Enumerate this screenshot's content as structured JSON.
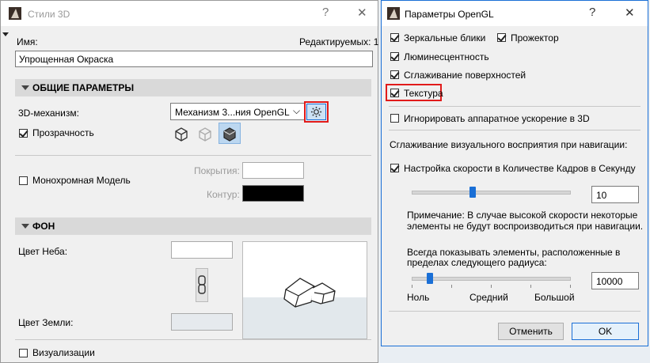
{
  "left_dialog": {
    "title": "Стили 3D",
    "help": "?",
    "close": "✕",
    "name_label": "Имя:",
    "editable_label": "Редактируемых: 1",
    "name_value": "Упрощенная Окраска",
    "general_section": "ОБЩИЕ ПАРАМЕТРЫ",
    "engine_label": "3D-механизм:",
    "engine_value": "Механизм 3...ния OpenGL",
    "transparency_label": "Прозрачность",
    "transparency_checked": true,
    "mono_label": "Монохромная Модель",
    "mono_checked": false,
    "surfaces_label": "Покрытия:",
    "contour_label": "Контур:",
    "background_section": "ФОН",
    "sky_label": "Цвет Неба:",
    "ground_label": "Цвет Земли:",
    "render_label": "Визуализации",
    "render_checked": false
  },
  "right_dialog": {
    "title": "Параметры OpenGL",
    "help": "?",
    "close": "✕",
    "specular_label": "Зеркальные блики",
    "specular_checked": true,
    "spotlight_label": "Прожектор",
    "spotlight_checked": true,
    "luminescence_label": "Люминесцентность",
    "luminescence_checked": true,
    "smoothing_label": "Сглаживание поверхностей",
    "smoothing_checked": true,
    "texture_label": "Текстура",
    "texture_checked": true,
    "ignore_hw_label": "Игнорировать аппаратное ускорение в 3D",
    "ignore_hw_checked": false,
    "nav_smoothing_label": "Сглаживание визуального восприятия при навигации:",
    "fps_label": "Настройка скорости в Количестве Кадров в Секунду",
    "fps_checked": true,
    "fps_value": "10",
    "fps_slider_fraction": 0.38,
    "note_line1": "Примечание: В случае высокой скорости некоторые",
    "note_line2": "элементы не будут воспроизводиться при навигации.",
    "radius_line1": "Всегда показывать элементы, расположенные в",
    "radius_line2": "пределах следующего радиуса:",
    "radius_value": "10000",
    "radius_slider_fraction": 0.1,
    "scale_low": "Ноль",
    "scale_mid": "Средний",
    "scale_high": "Большой",
    "cancel_button": "Отменить",
    "ok_button": "OK"
  },
  "colors": {
    "highlight_red": "#e11b1b",
    "accent_blue": "#1a6fd6",
    "contour_swatch": "#000000"
  }
}
